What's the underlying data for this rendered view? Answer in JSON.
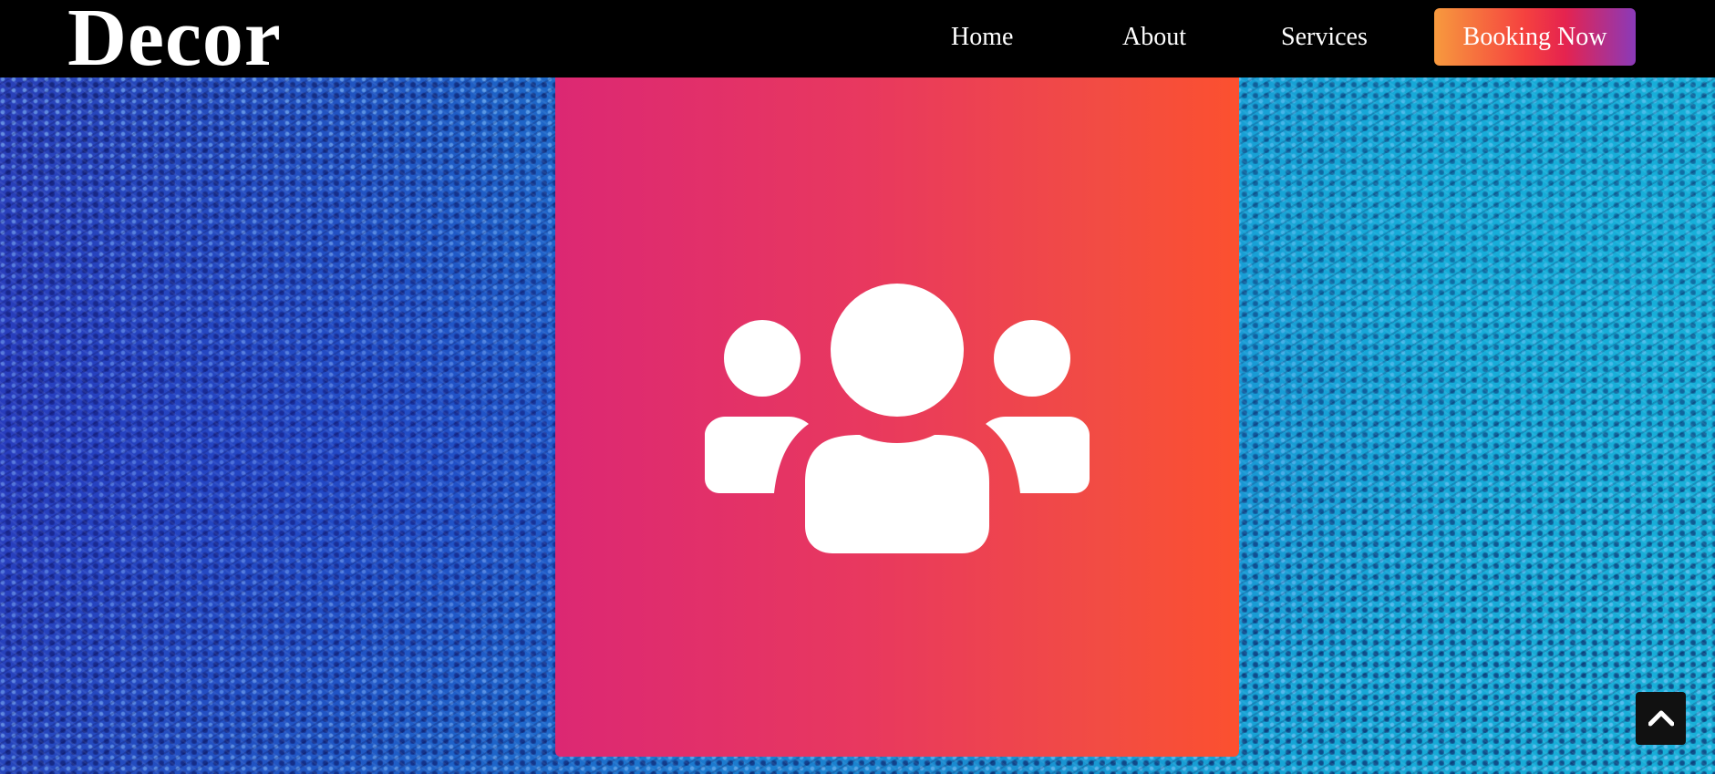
{
  "header": {
    "brand": "Decor",
    "nav": {
      "home": "Home",
      "about": "About",
      "services": "Services"
    },
    "booking_label": "Booking Now"
  },
  "feature": {
    "icon": "users-group-icon",
    "gradient_colors": [
      "#dc2873",
      "#fc502f"
    ]
  },
  "scroll_top": {
    "icon": "chevron-up-icon"
  },
  "colors": {
    "navbar": "#000000",
    "button_gradient": [
      "#f79a3e",
      "#f5413f",
      "#8a3ab9"
    ]
  }
}
